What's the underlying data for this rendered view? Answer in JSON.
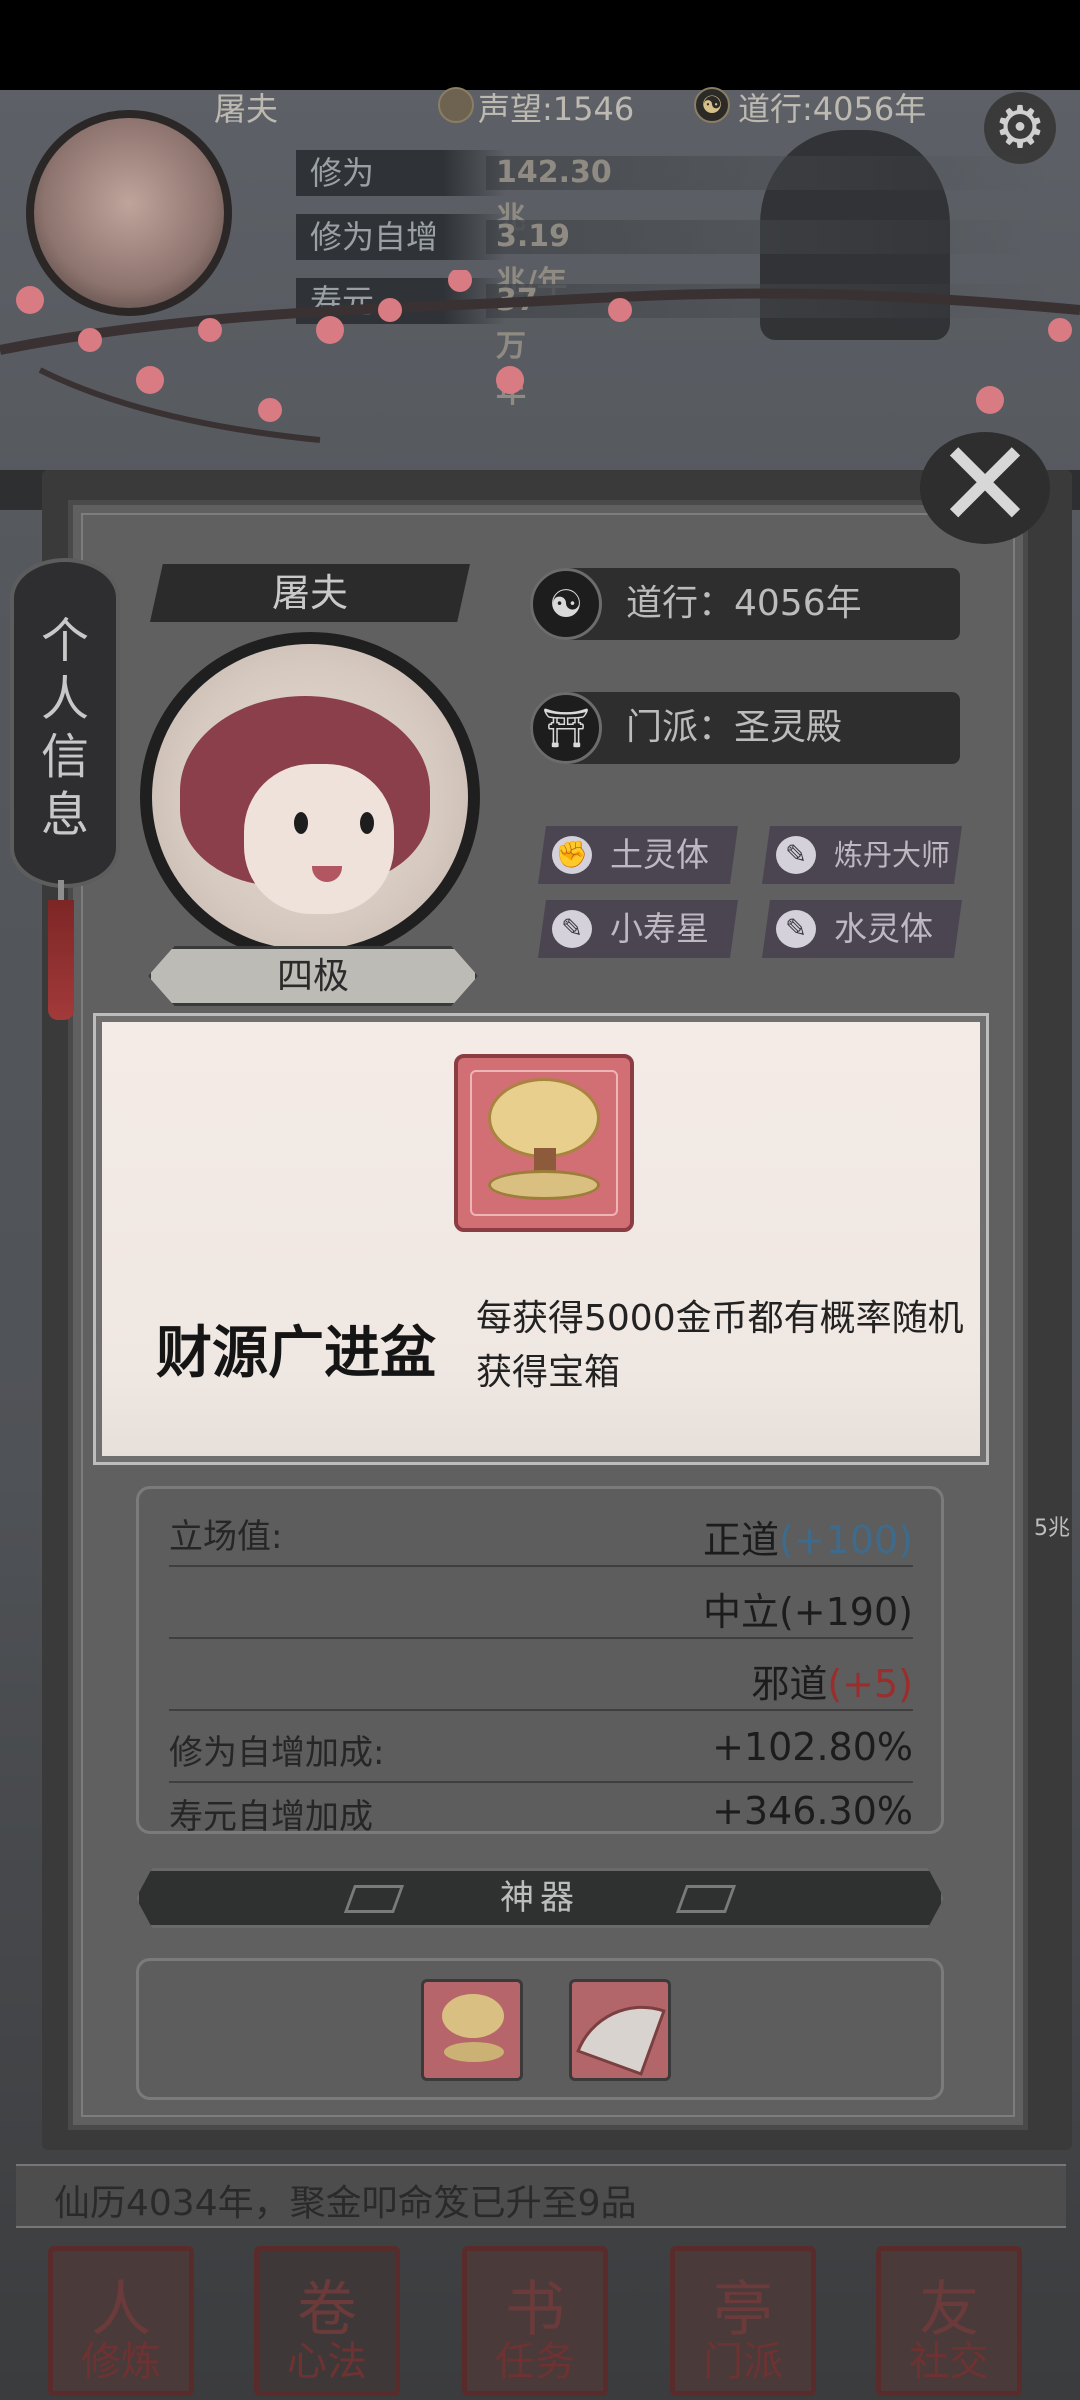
{
  "hud": {
    "player_name": "屠夫",
    "fame": "声望:1546",
    "dao": "道行:4056年",
    "dao_icon": "☯",
    "settings_icon": "gear-icon",
    "stats": [
      {
        "label": "修为",
        "value": "142.30兆"
      },
      {
        "label": "修为自增",
        "value": "3.19兆/年"
      },
      {
        "label": "寿元",
        "value": "37万年"
      }
    ]
  },
  "panel": {
    "side_tab": "个人信息",
    "name": "屠夫",
    "rank": "四极",
    "dao_line": "道行：4056年",
    "sect_line": "门派：圣灵殿",
    "traits": [
      "土灵体",
      "炼丹大师",
      "小寿星",
      "水灵体"
    ],
    "close_icon": "close-icon"
  },
  "popup": {
    "title": "财源广进盆",
    "description": "每获得5000金币都有概率随机获得宝箱",
    "bg_color": "#d26f74"
  },
  "stats": {
    "stance_label": "立场值:",
    "righteous": "正道",
    "righteous_bonus": "(+100)",
    "neutral": "中立(+190)",
    "evil": "邪道",
    "evil_bonus": "(+5)",
    "cultivation_label": "修为自增加成:",
    "cultivation_value": "+102.80%",
    "lifespan_label": "寿元自增加成",
    "lifespan_value": "+346.30%"
  },
  "artifacts": {
    "header": "神器",
    "items": [
      "财源广进盆",
      "折扇"
    ]
  },
  "side_peek": "5兆",
  "log": "仙历4034年，聚金叩命笈已升至9品",
  "nav": [
    {
      "label": "修炼",
      "glyph": "人"
    },
    {
      "label": "心法",
      "glyph": "卷"
    },
    {
      "label": "任务",
      "glyph": "书"
    },
    {
      "label": "门派",
      "glyph": "亭"
    },
    {
      "label": "社交",
      "glyph": "友"
    }
  ]
}
